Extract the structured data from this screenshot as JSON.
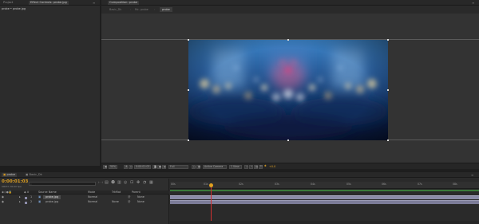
{
  "project_panel": {
    "tab_project": "Project",
    "tab_effect_controls": "Effect Controls: probe.jpg",
    "breadcrumb": "probe • probe.jpg",
    "menu_icon": "panel-menu-icon"
  },
  "composition_panel": {
    "tab_label": "Composition: probe",
    "nav_tabs": [
      "Basic_Dk",
      "Mc. probe",
      "probe"
    ],
    "active_nav": "probe"
  },
  "viewer_controls": {
    "zoom": "50%",
    "timecode": "0:00:01:03",
    "resolution": "Full",
    "camera": "Active Camera",
    "views": "1 View",
    "exposure": "+0.0"
  },
  "timeline_tabs": [
    "probe",
    "Basic_Dk"
  ],
  "timeline": {
    "current_time": "0:00:01:03",
    "frame_info": "00033 (30.00 fps)",
    "search_placeholder": "",
    "column_headers": {
      "source_name": "Source Name",
      "mode": "Mode",
      "trkmat": "TrkMat",
      "parent": "Parent"
    },
    "layers": [
      {
        "index": "1",
        "name": "probe.jpg",
        "mode": "Normal",
        "trkmat": "",
        "parent": "None"
      },
      {
        "index": "2",
        "name": "probe.jpg",
        "mode": "Normal",
        "trkmat": "None",
        "parent": "None"
      }
    ],
    "ruler_labels": [
      "00s",
      "01s",
      "02s",
      "03s",
      "04s",
      "05s",
      "06s",
      "07s",
      "08s"
    ]
  },
  "colors": {
    "accent": "#e0a020",
    "layer_bar": "#8c8ca8",
    "playhead": "#d03030",
    "work_area": "#3a7a3a"
  }
}
